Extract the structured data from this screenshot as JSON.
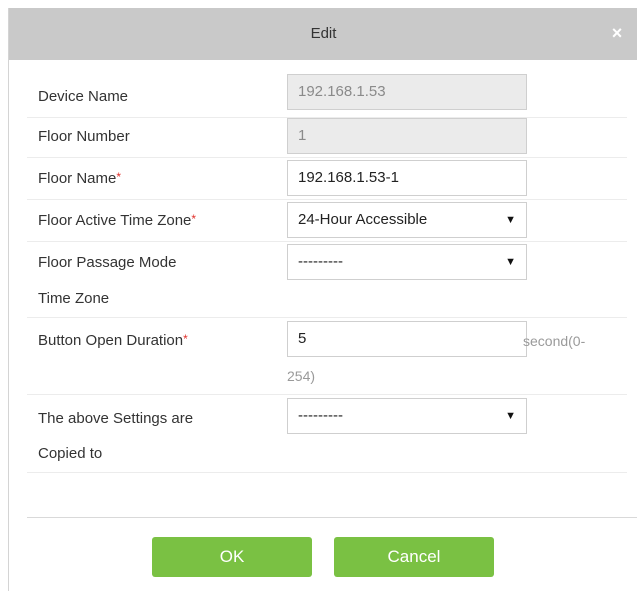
{
  "dialog": {
    "title": "Edit",
    "close_symbol": "×",
    "required_mark": "*"
  },
  "fields": {
    "device_name": {
      "label": "Device Name",
      "value": "192.168.1.53"
    },
    "floor_number": {
      "label": "Floor Number",
      "value": "1"
    },
    "floor_name": {
      "label": "Floor Name",
      "value": "192.168.1.53-1"
    },
    "active_tz": {
      "label": "Floor Active Time Zone",
      "value": "24-Hour Accessible"
    },
    "passage_tz": {
      "label_line1": "Floor Passage Mode",
      "label_line2": "Time Zone",
      "value": "---------"
    },
    "button_duration": {
      "label": "Button Open Duration",
      "value": "5",
      "hint_line1": "second(0-",
      "hint_line2": "254)"
    },
    "copy_to": {
      "label_line1": "The above Settings are",
      "label_line2": "Copied to",
      "value": "---------"
    }
  },
  "buttons": {
    "ok": "OK",
    "cancel": "Cancel"
  },
  "colors": {
    "titlebar": "#c9c9c9",
    "button": "#7ac143",
    "required": "#e0302a"
  },
  "icons": {
    "close": "close-icon",
    "dropdown": "chevron-down-icon"
  }
}
